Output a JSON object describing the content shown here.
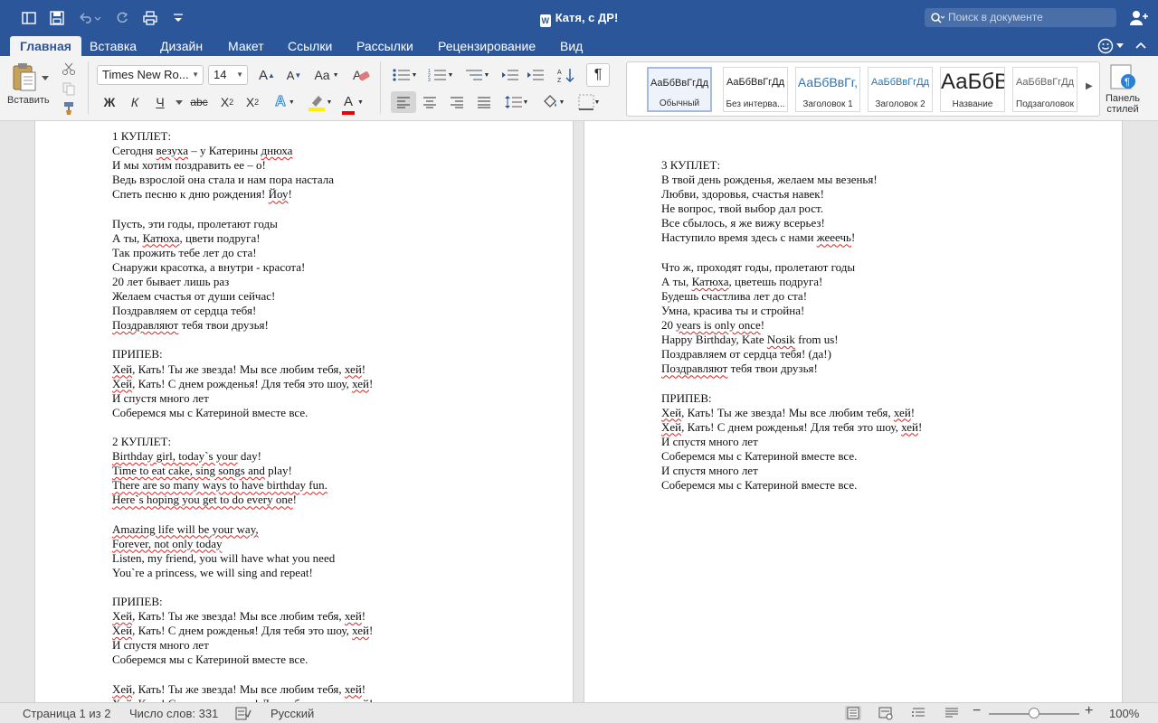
{
  "title_bar": {
    "doc_title": "Катя, с ДР!",
    "search_placeholder": "Поиск в документе"
  },
  "tabs": [
    {
      "label": "Главная",
      "active": true
    },
    {
      "label": "Вставка"
    },
    {
      "label": "Дизайн"
    },
    {
      "label": "Макет"
    },
    {
      "label": "Ссылки"
    },
    {
      "label": "Рассылки"
    },
    {
      "label": "Рецензирование"
    },
    {
      "label": "Вид"
    }
  ],
  "ribbon": {
    "paste_label": "Вставить",
    "font_name": "Times New Ro...",
    "font_size": "14",
    "bold": "Ж",
    "italic": "К",
    "underline": "Ч",
    "strike": "abc",
    "styles": [
      {
        "preview": "АаБбВвГгДд",
        "label": "Обычный",
        "selected": true
      },
      {
        "preview": "АаБбВвГгДд",
        "label": "Без интерва..."
      },
      {
        "preview": "АаБбВвГг,",
        "label": "Заголовок 1"
      },
      {
        "preview": "АаБбВвГгДд",
        "label": "Заголовок 2"
      },
      {
        "preview": "АаБбВ",
        "label": "Название"
      },
      {
        "preview": "АаБбВвГгДд",
        "label": "Подзаголовок"
      }
    ],
    "styles_pane_label_1": "Панель",
    "styles_pane_label_2": "стилей"
  },
  "page_left": {
    "lines": [
      "1 КУПЛЕТ:",
      "Сегодня <u>везуха</u> – у Катерины <u>днюха</u>",
      "И мы хотим поздравить ее – о!",
      "Ведь взрослой она стала и нам пора настала",
      "Спеть песню к дню рождения! <u>Йоу</u>!",
      "",
      "Пусть, эти годы, пролетают годы",
      "А ты, <u>Катюха</u>, цвети подруга!",
      "Так прожить тебе лет до ста!",
      "Снаружи красотка, а внутри - красота!",
      "20 лет бывает лишь раз",
      "Желаем счастья от души сейчас!",
      "Поздравляем от сердца тебя!",
      "<u>Поздравляют</u> тебя твои друзья!",
      "",
      "ПРИПЕВ:",
      "<u>Хей</u>, Кать! Ты же звезда! Мы все любим тебя, <u>хей</u>!",
      "<u>Хей</u>, Кать! С днем рожденья! Для тебя это шоу, <u>хей</u>!",
      "И спустя много лет",
      "Соберемся мы с Катериной вместе все.",
      "",
      "2 КУПЛЕТ:",
      "<u>Birthday girl, today`s your</u> day!",
      "<u>Time to eat cake, sing songs and</u> play!",
      "<u>There are so many ways to have birthday fun.</u>",
      "<u>Here`s hoping you get to do every one</u>!",
      "",
      "<u>Amazing life will be your way,</u>",
      "<u>Forever, not only today</u>",
      "Listen, my friend, you will have what you need",
      "You`re a princess, we will sing and repeat!",
      "",
      "ПРИПЕВ:",
      "<u>Хей</u>, Кать! Ты же звезда! Мы все любим тебя, <u>хей</u>!",
      "<u>Хей</u>, Кать! С днем рожденья! Для тебя это шоу, <u>хей</u>!",
      "И спустя много лет",
      "Соберемся мы с Катериной вместе все.",
      "",
      "<u>Хей</u>, Кать! Ты же звезда! Мы все любим тебя, <u>хей</u>!",
      "<u>Хей</u>, Кать! С днем рожденья! Для тебя это шоу, <u>хей</u>!"
    ]
  },
  "page_right": {
    "lines": [
      "3 КУПЛЕТ:",
      "В твой день рожденья, желаем мы везенья!",
      "Любви, здоровья, счастья навек!",
      "Не вопрос, твой выбор дал рост.",
      "Все сбылось, я же вижу всерьез!",
      "Наступило время здесь с нами <u>жееечь</u>!",
      "",
      "Что ж, проходят годы, пролетают годы",
      "А ты, <u>Катюха</u>, цветешь подруга!",
      "Будешь счастлива лет до ста!",
      "Умна, красива ты и стройна!",
      "20 <u>years is only once</u>!",
      "Happy Birthday, Kate <u>Nosik</u> from us!",
      "Поздравляем от сердца тебя! (да!)",
      "<u>Поздравляют</u> тебя твои друзья!",
      "",
      "ПРИПЕВ:",
      "<u>Хей</u>, Кать! Ты же звезда! Мы все любим тебя, <u>хей</u>!",
      "<u>Хей</u>, Кать! С днем рожденья! Для тебя это шоу, <u>хей</u>!",
      "И спустя много лет",
      "Соберемся мы с Катериной вместе все.",
      "И спустя много лет",
      "Соберемся мы с Катериной вместе все."
    ]
  },
  "status_bar": {
    "page": "Страница 1 из 2",
    "words": "Число слов: 331",
    "language": "Русский",
    "zoom": "100%",
    "zoom_level_percent": 100
  },
  "colors": {
    "brand": "#2b579a",
    "squiggle": "#dd2222"
  }
}
